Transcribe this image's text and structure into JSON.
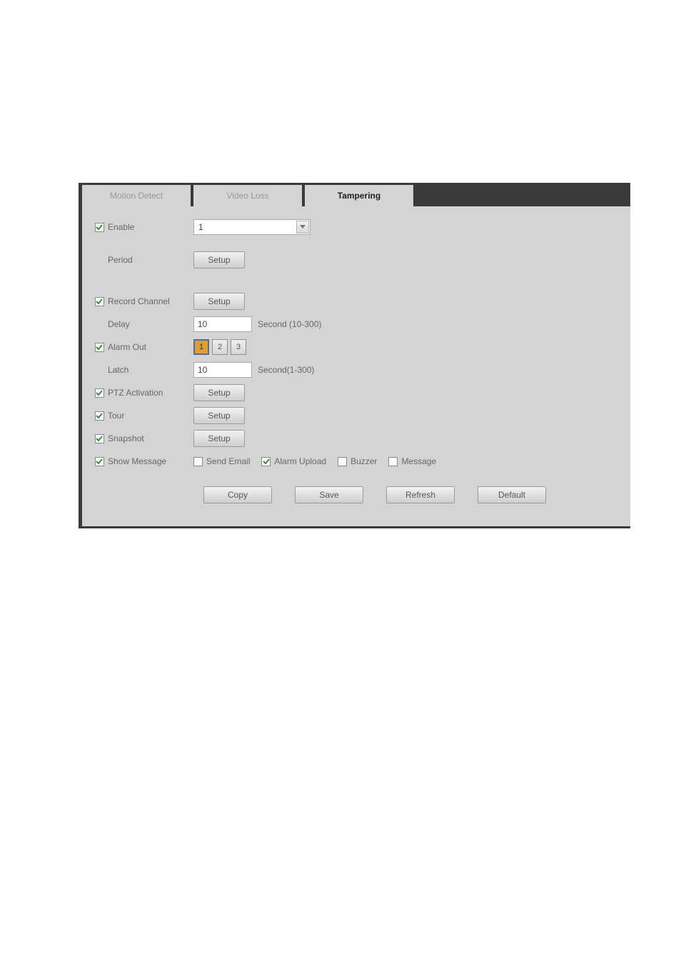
{
  "tabs": {
    "motion_detect": "Motion Detect",
    "video_loss": "Video Loss",
    "tampering": "Tampering"
  },
  "labels": {
    "enable": "Enable",
    "period": "Period",
    "record_channel": "Record Channel",
    "delay": "Delay",
    "alarm_out": "Alarm Out",
    "latch": "Latch",
    "ptz_activation": "PTZ Activation",
    "tour": "Tour",
    "snapshot": "Snapshot",
    "show_message": "Show Message",
    "send_email": "Send Email",
    "alarm_upload": "Alarm Upload",
    "buzzer": "Buzzer",
    "message": "Message"
  },
  "values": {
    "channel": "1",
    "delay": "10",
    "latch": "10"
  },
  "hints": {
    "delay": "Second (10-300)",
    "latch": "Second(1-300)"
  },
  "alarm_out": {
    "options": [
      "1",
      "2",
      "3"
    ],
    "selected": "1"
  },
  "checkboxes": {
    "enable": true,
    "record_channel": true,
    "alarm_out": true,
    "ptz_activation": true,
    "tour": true,
    "snapshot": true,
    "show_message": true,
    "send_email": false,
    "alarm_upload": true,
    "buzzer": false,
    "message": false
  },
  "buttons": {
    "setup": "Setup",
    "copy": "Copy",
    "save": "Save",
    "refresh": "Refresh",
    "default": "Default"
  }
}
